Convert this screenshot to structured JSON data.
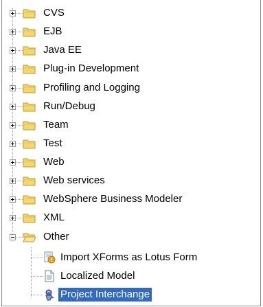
{
  "tree": {
    "folders": [
      {
        "label": "CVS",
        "expanded": false
      },
      {
        "label": "EJB",
        "expanded": false
      },
      {
        "label": "Java EE",
        "expanded": false
      },
      {
        "label": "Plug-in Development",
        "expanded": false
      },
      {
        "label": "Profiling and Logging",
        "expanded": false
      },
      {
        "label": "Run/Debug",
        "expanded": false
      },
      {
        "label": "Team",
        "expanded": false
      },
      {
        "label": "Test",
        "expanded": false
      },
      {
        "label": "Web",
        "expanded": false
      },
      {
        "label": "Web services",
        "expanded": false
      },
      {
        "label": "WebSphere Business Modeler",
        "expanded": false
      },
      {
        "label": "XML",
        "expanded": false
      },
      {
        "label": "Other",
        "expanded": true
      }
    ],
    "other_children": [
      {
        "label": "Import XForms as Lotus Form",
        "icon": "import-form-icon",
        "selected": false
      },
      {
        "label": "Localized Model",
        "icon": "document-icon",
        "selected": false
      },
      {
        "label": "Project Interchange",
        "icon": "project-interchange-icon",
        "selected": true
      }
    ],
    "colors": {
      "selection": "#316ac5",
      "folder_fill": "#f6d76b",
      "folder_stroke": "#b89a36"
    }
  }
}
